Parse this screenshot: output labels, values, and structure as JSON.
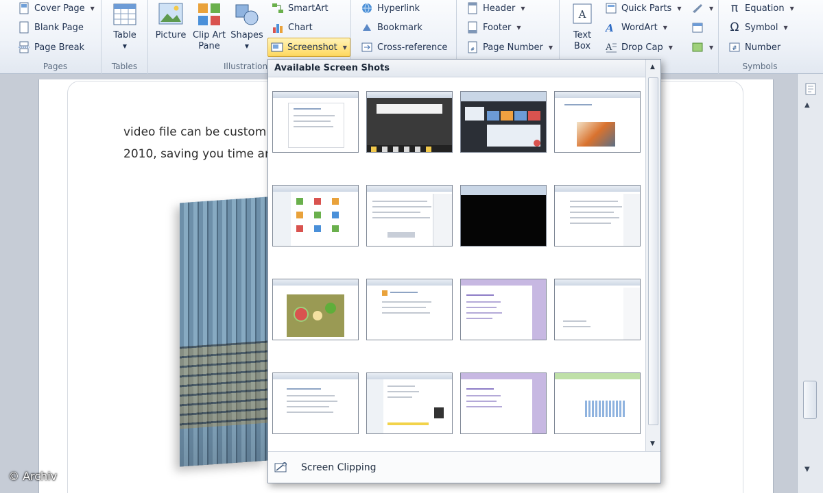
{
  "ribbon": {
    "pages": {
      "label": "Pages",
      "cover": "Cover Page",
      "blank": "Blank Page",
      "break": "Page Break"
    },
    "tables": {
      "label": "Tables",
      "table": "Table"
    },
    "illustrations": {
      "label": "Illustrations",
      "picture": "Picture",
      "clipart_1": "Clip Art",
      "clipart_2": "Pane",
      "shapes": "Shapes",
      "smartart": "SmartArt",
      "chart": "Chart",
      "screenshot": "Screenshot"
    },
    "links": {
      "hyperlink": "Hyperlink",
      "bookmark": "Bookmark",
      "crossref": "Cross-reference"
    },
    "header_footer": {
      "header": "Header",
      "footer": "Footer",
      "page_number": "Page Number"
    },
    "text": {
      "textbox_1": "Text",
      "textbox_2": "Box",
      "quick_parts": "Quick Parts",
      "wordart": "WordArt",
      "dropcap": "Drop Cap"
    },
    "symbols": {
      "label": "Symbols",
      "equation": "Equation",
      "symbol": "Symbol",
      "number": "Number"
    }
  },
  "document": {
    "line1": "video file can be custom",
    "line2": "2010, saving you time ar"
  },
  "gallery": {
    "title": "Available Screen Shots",
    "clipping": "Screen Clipping"
  },
  "watermark": "© Archiv",
  "colors": {
    "highlight": "#ffd95e",
    "accent": "#1f3150"
  }
}
